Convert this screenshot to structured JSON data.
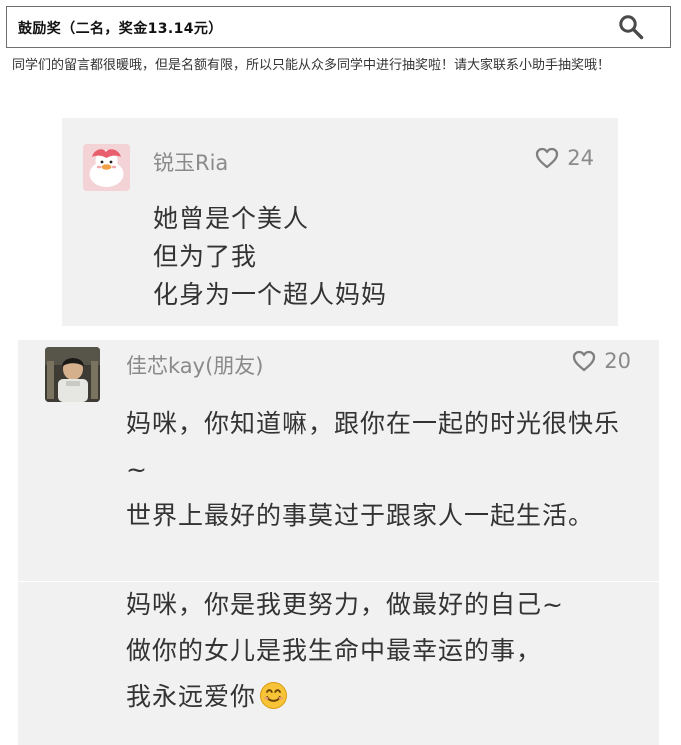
{
  "header": {
    "title": "鼓励奖（二名，奖金13.14元）",
    "search_icon": "search-icon"
  },
  "intro": {
    "text": "同学们的留言都很暖哦，但是名额有限，所以只能从众多同学中进行抽奖啦！请大家联系小助手抽奖哦！"
  },
  "comments": [
    {
      "username": "锐玉Ria",
      "likes": "24",
      "avatar_icon": "duck-avatar",
      "lines": [
        "她曾是个美人",
        "但为了我",
        "化身为一个超人妈妈"
      ]
    },
    {
      "username": "佳芯kay(朋友)",
      "likes": "20",
      "avatar_icon": "child-photo-avatar",
      "lines": [
        "妈咪，你知道嘛，跟你在一起的时光很快乐~",
        "世界上最好的事莫过于跟家人一起生活。"
      ],
      "continuation": {
        "lines": [
          "妈咪，你是我更努力，做最好的自己~",
          "做你的女儿是我生命中最幸运的事，",
          "我永远爱你"
        ],
        "emoji_icon": "smiling-face-icon"
      }
    }
  ],
  "colors": {
    "card_background": "#f1f1f1",
    "muted_text": "#8a8a8a",
    "body_text": "#333333",
    "border": "#6f6f6f"
  }
}
